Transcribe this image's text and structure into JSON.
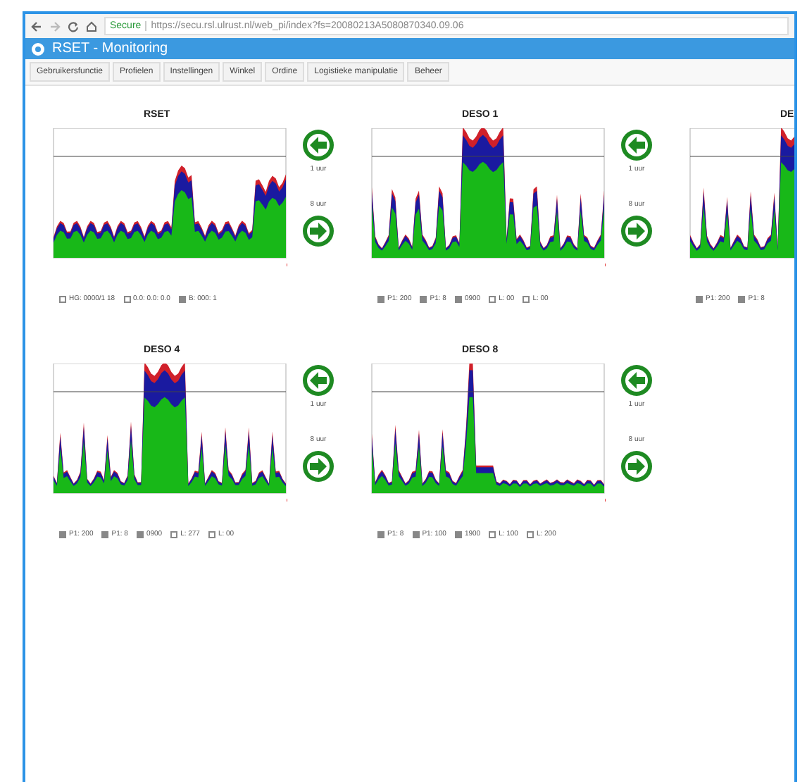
{
  "browser": {
    "security_label": "Secure",
    "url": "https://secu.rsl.ulrust.nl/web_pi/index?fs=20080213A5080870340.09.06"
  },
  "app": {
    "title": "RSET - Monitoring"
  },
  "tabs": [
    {
      "label": "Gebruikersfunctie",
      "selected": false
    },
    {
      "label": "Profielen",
      "selected": false
    },
    {
      "label": "Instellingen",
      "selected": false
    },
    {
      "label": "Winkel",
      "selected": false
    },
    {
      "label": "Ordine",
      "selected": false
    },
    {
      "label": "Logistieke manipulatie",
      "selected": false
    },
    {
      "label": "Beheer",
      "selected": false
    }
  ],
  "panels": [
    {
      "title": "RSET",
      "prev_label": "1 uur",
      "next_label": "8 uur",
      "legend": [
        {
          "label": "HG: 0000/1 18",
          "checked": false
        },
        {
          "label": "0.0: 0.0: 0.0",
          "checked": false
        },
        {
          "label": "B: 000: 1",
          "checked": true
        }
      ]
    },
    {
      "title": "DESO 1",
      "prev_label": "1 uur",
      "next_label": "8 uur",
      "legend": [
        {
          "label": "P1: 200",
          "checked": true
        },
        {
          "label": "P1: 8",
          "checked": true
        },
        {
          "label": "0900",
          "checked": true
        },
        {
          "label": "L: 00",
          "checked": false
        },
        {
          "label": "L: 00",
          "checked": false
        }
      ]
    },
    {
      "title": "DE",
      "legend": [
        {
          "label": "P1: 200",
          "checked": true
        },
        {
          "label": "P1: 8",
          "checked": true
        }
      ]
    },
    {
      "title": "DESO 4",
      "prev_label": "1 uur",
      "next_label": "8 uur",
      "legend": [
        {
          "label": "P1: 200",
          "checked": true
        },
        {
          "label": "P1: 8",
          "checked": true
        },
        {
          "label": "0900",
          "checked": true
        },
        {
          "label": "L: 277",
          "checked": false
        },
        {
          "label": "L: 00",
          "checked": false
        }
      ]
    },
    {
      "title": "DESO 8",
      "prev_label": "1 uur",
      "next_label": "8 uur",
      "legend": [
        {
          "label": "P1: 8",
          "checked": true
        },
        {
          "label": "P1: 100",
          "checked": true
        },
        {
          "label": "1900",
          "checked": true
        },
        {
          "label": "L: 100",
          "checked": false
        },
        {
          "label": "L: 200",
          "checked": false
        }
      ]
    }
  ]
}
